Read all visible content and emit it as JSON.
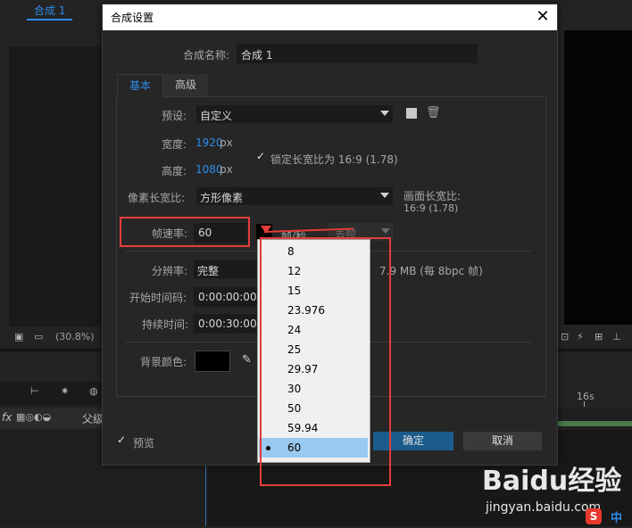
{
  "background_app": {
    "comp_tab": "合成 1",
    "zoom": "(30.8%)",
    "timeline_mark": "16s",
    "layer_col": "父级"
  },
  "dialog": {
    "title": "合成设置",
    "comp_name_label": "合成名称:",
    "comp_name_value": "合成 1",
    "tabs": [
      "基本",
      "高级"
    ],
    "preset_label": "预设:",
    "preset_value": "自定义",
    "width_label": "宽度:",
    "width_value": "1920",
    "height_label": "高度:",
    "height_value": "1080",
    "px_unit": "px",
    "lock_label": "锁定长宽比为 16:9 (1.78)",
    "pixel_aspect_label": "像素长宽比:",
    "pixel_aspect_value": "方形像素",
    "frame_aspect_label": "画面长宽比:",
    "frame_aspect_value": "16:9 (1.78)",
    "frame_rate_label": "帧速率:",
    "frame_rate_value": "60",
    "fps_unit": "帧/秒",
    "drop_frame_value": "丢帧",
    "resolution_label": "分辨率:",
    "resolution_value": "完整",
    "resolution_info": "7.9 MB (每 8bpc 帧)",
    "start_tc_label": "开始时间码:",
    "start_tc_value": "0:00:00:00",
    "duration_label": "持续时间:",
    "duration_value": "0:00:30:00",
    "bg_color_label": "背景颜色:",
    "bg_color": "#000000",
    "preview_label": "预览",
    "ok_label": "确定",
    "cancel_label": "取消"
  },
  "frame_rate_options": [
    "8",
    "12",
    "15",
    "23.976",
    "24",
    "25",
    "29.97",
    "30",
    "50",
    "59.94",
    "60"
  ],
  "frame_rate_selected": "60",
  "watermark": {
    "logo": "Baidu经验",
    "url": "jingyan.baidu.com",
    "sogou_s": "S",
    "sogou_zh": "中"
  },
  "colors": {
    "accent": "#2d8ceb",
    "annotation": "#e53c3c",
    "selection": "#99c9ef"
  }
}
